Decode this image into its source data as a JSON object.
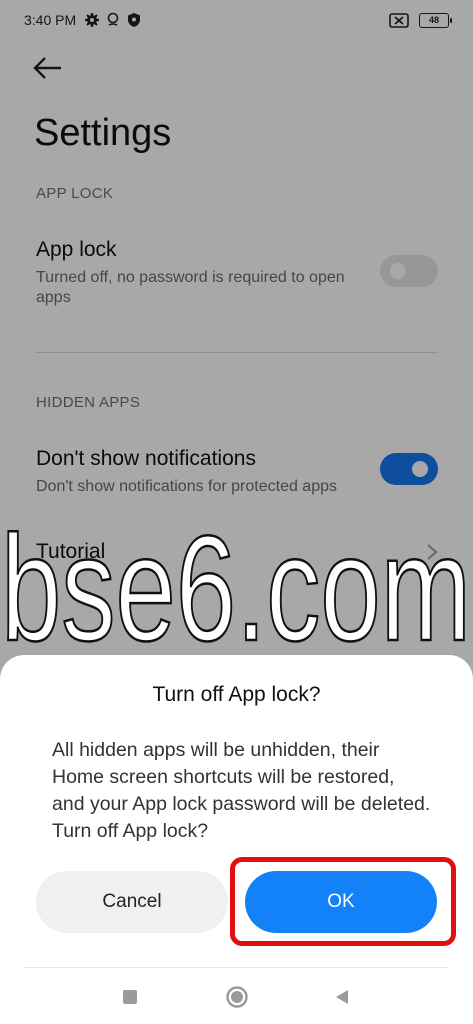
{
  "status_bar": {
    "time": "3:40 PM",
    "battery": "48",
    "icons": [
      "gear-icon",
      "location-icon",
      "shield-icon",
      "sim-off-icon",
      "battery-icon"
    ]
  },
  "settings": {
    "title": "Settings",
    "sections": {
      "app_lock_header": "APP LOCK",
      "app_lock_title": "App lock",
      "app_lock_subtitle": "Turned off, no password is required to open apps",
      "app_lock_enabled": false,
      "hidden_apps_header": "HIDDEN APPS",
      "notifications_title": "Don't show notifications",
      "notifications_subtitle": "Don't show notifications for protected apps",
      "notifications_enabled": true,
      "tutorial_title": "Tutorial"
    }
  },
  "watermark": {
    "text": "bse6.com"
  },
  "dialog": {
    "title": "Turn off App lock?",
    "message": "All hidden apps will be unhidden, their Home screen shortcuts will be restored, and your App lock password will be deleted. Turn off App lock?",
    "cancel_label": "Cancel",
    "ok_label": "OK"
  },
  "colors": {
    "accent": "#1382f8",
    "toggle_on": "#1777f0",
    "highlight": "#e01010",
    "overlay": "rgba(0,0,0,0.34)"
  },
  "navbar": {
    "icons": [
      "recents-square-icon",
      "home-circle-icon",
      "back-triangle-icon"
    ]
  }
}
